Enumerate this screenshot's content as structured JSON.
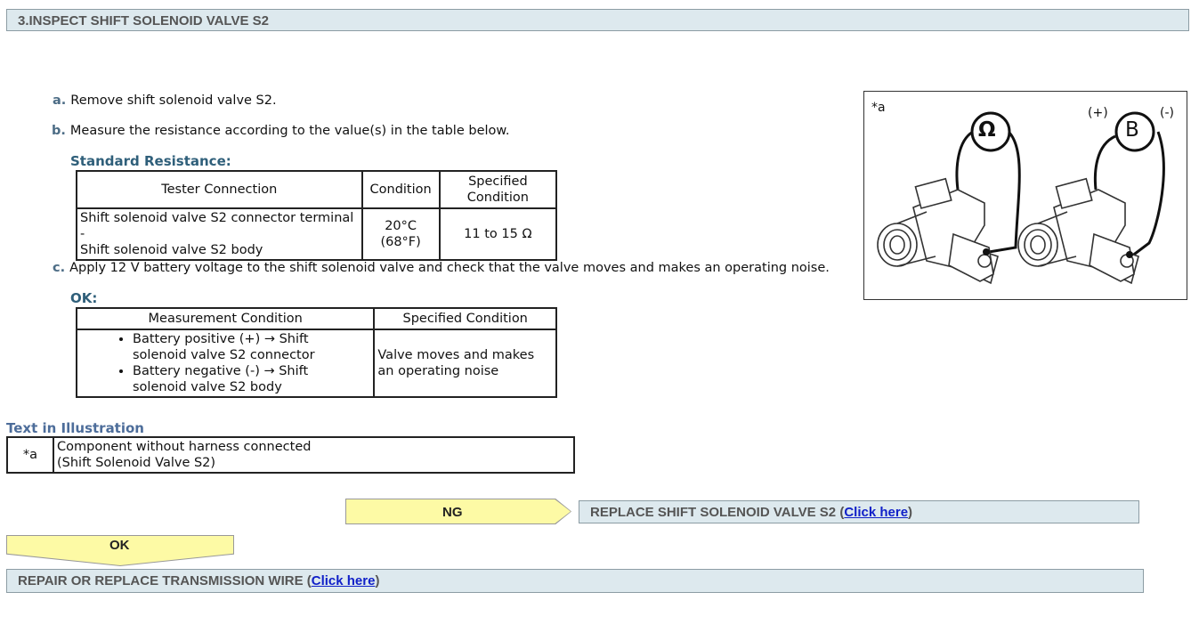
{
  "header": {
    "title": "3.INSPECT SHIFT SOLENOID VALVE S2"
  },
  "steps": [
    {
      "letter": "a.",
      "text": "Remove shift solenoid valve S2."
    },
    {
      "letter": "b.",
      "text": "Measure the resistance according to the value(s) in the table below."
    },
    {
      "letter": "c.",
      "text": "Apply 12 V battery voltage to the shift solenoid valve and check that the valve moves and makes an operating noise."
    }
  ],
  "standard_resistance": {
    "label": "Standard Resistance:",
    "headers": [
      "Tester Connection",
      "Condition",
      "Specified Condition"
    ],
    "row": {
      "connection_line1": "Shift solenoid valve S2 connector terminal -",
      "connection_line2": "Shift solenoid valve S2 body",
      "condition_line1": "20°C",
      "condition_line2": "(68°F)",
      "specified": "11 to 15 Ω"
    }
  },
  "ok_table": {
    "label": "OK:",
    "headers": [
      "Measurement Condition",
      "Specified Condition"
    ],
    "bullets": [
      "Battery positive (+) → Shift solenoid valve S2 connector",
      "Battery negative (-) → Shift solenoid valve S2 body"
    ],
    "specified": "Valve moves and makes an operating noise"
  },
  "illustration": {
    "label": "Text in Illustration",
    "key": "*a",
    "desc_line1": "Component without harness connected",
    "desc_line2": "(Shift Solenoid Valve S2)"
  },
  "figure": {
    "tag": "*a",
    "ohm_symbol": "Ω",
    "battery_symbol": "B",
    "plus": "(+)",
    "minus": "(-)"
  },
  "flow": {
    "ng_label": "NG",
    "ng_result": "REPLACE SHIFT SOLENOID VALVE S2",
    "ok_label": "OK",
    "ok_result": "REPAIR OR REPLACE TRANSMISSION WIRE",
    "link_text": "Click here",
    "paren_open": "(",
    "paren_close": ")"
  }
}
